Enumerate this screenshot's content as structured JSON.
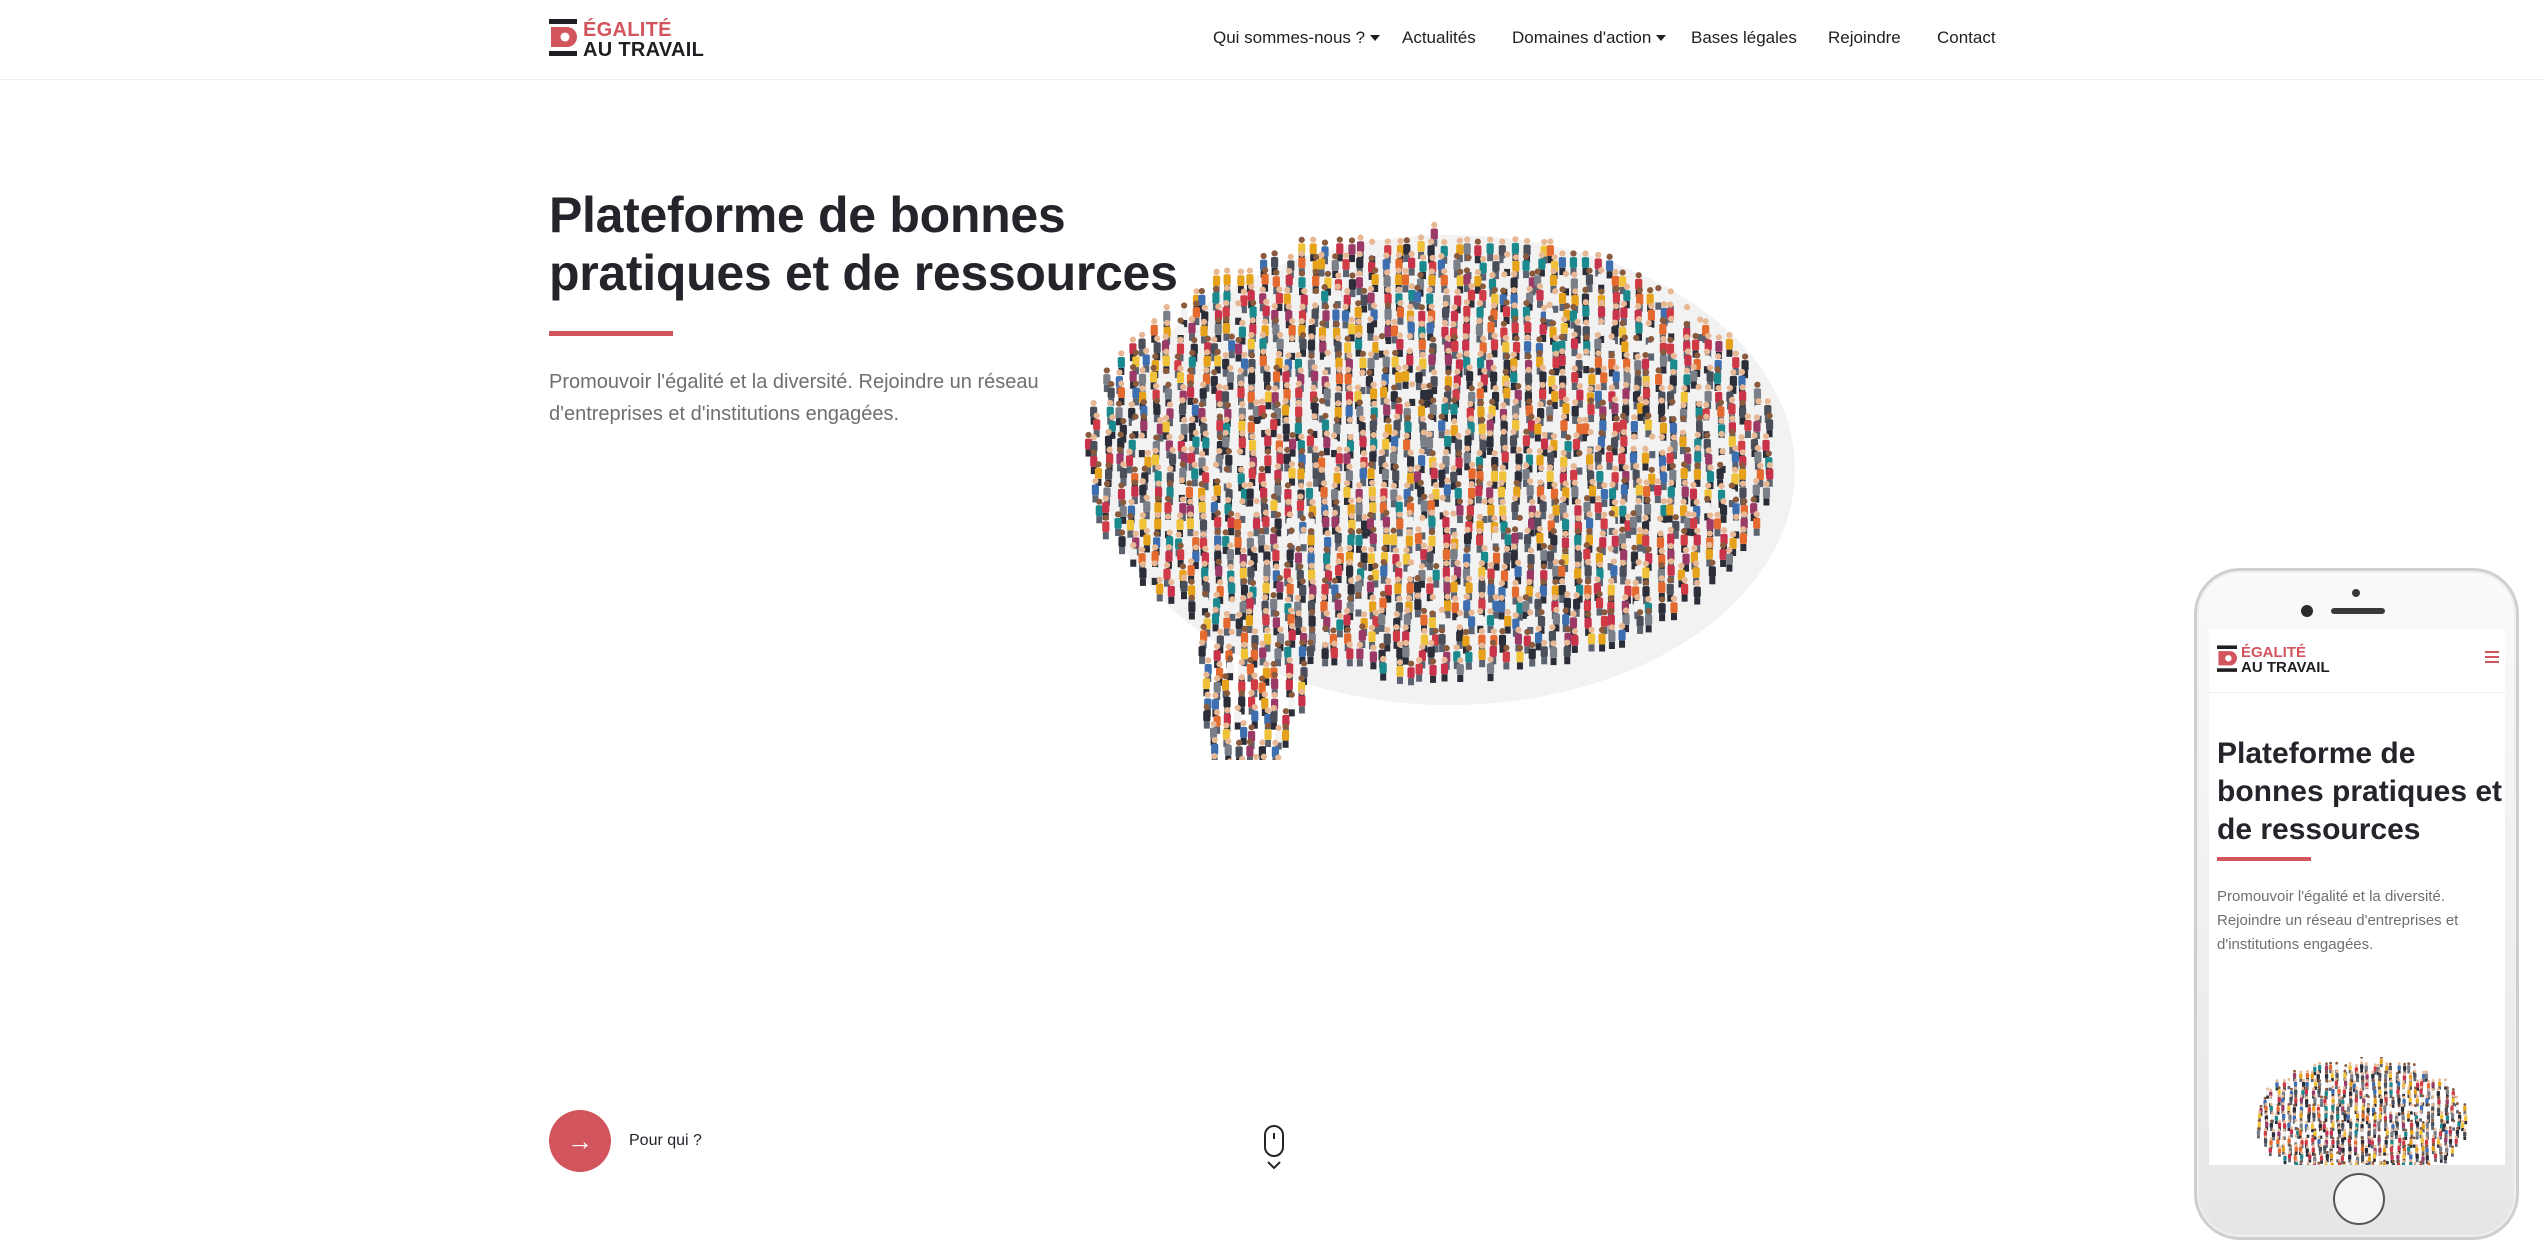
{
  "brand": {
    "line1": "ÉGALITÉ",
    "line2": "AU TRAVAIL",
    "accent": "#d2555d",
    "dark": "#1f1f23"
  },
  "nav": {
    "items": [
      {
        "label": "Qui sommes-nous ?",
        "dropdown": true
      },
      {
        "label": "Actualités",
        "dropdown": false
      },
      {
        "label": "Domaines d'action",
        "dropdown": true
      },
      {
        "label": "Bases légales",
        "dropdown": false
      },
      {
        "label": "Rejoindre",
        "dropdown": false
      },
      {
        "label": "Contact",
        "dropdown": false
      }
    ]
  },
  "hero": {
    "title": "Plateforme de bonnes pratiques et de ressources",
    "subtitle": "Promouvoir l'égalité et la diversité. Rejoindre un réseau d'entreprises et d'institutions engagées.",
    "image_icon": "speech-bubble-crowd-illustration",
    "cta_icon": "arrow-right-icon",
    "cta_label": "Pour qui ?",
    "scroll_icon": "scroll-mouse-icon"
  },
  "mobile_preview": {
    "brand_line1": "ÉGALITÉ",
    "brand_line2": "AU TRAVAIL",
    "menu_icon": "hamburger-menu-icon",
    "title": "Plateforme de bonnes pratiques et de ressources",
    "subtitle": "Promouvoir l'égalité et la diversité. Rejoindre un réseau d'entreprises et d'institutions engagées."
  }
}
